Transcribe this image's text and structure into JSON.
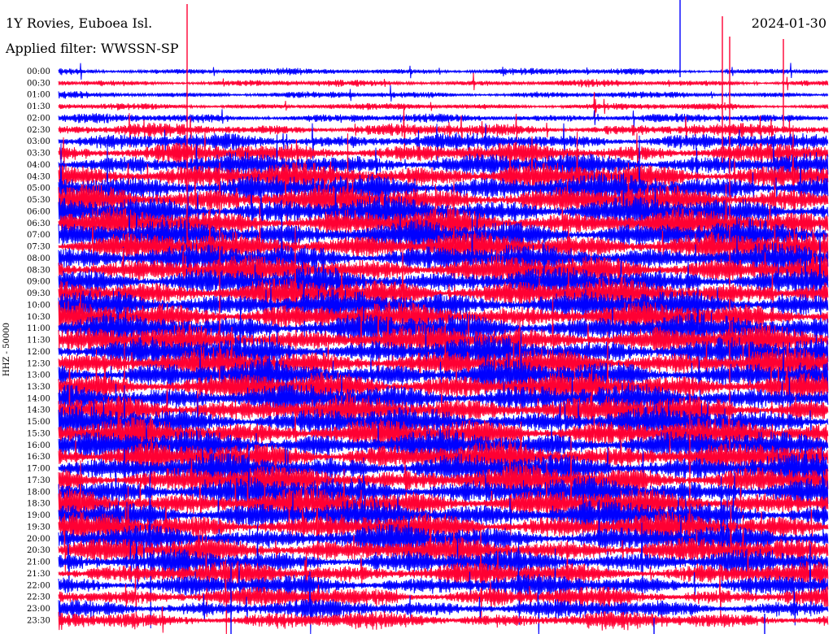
{
  "header": {
    "title": "1Y Rovies, Euboea Isl.",
    "filter": "Applied filter: WWSSN-SP",
    "date": "2024-01-30"
  },
  "chart_data": {
    "type": "line",
    "title": "1Y Rovies, Euboea Isl.",
    "subtitle": "Applied filter: WWSSN-SP",
    "date": "2024-01-30",
    "ylabel": "HHZ - 50000",
    "rows": [
      "00:00",
      "00:30",
      "01:00",
      "01:30",
      "02:00",
      "02:30",
      "03:00",
      "03:30",
      "04:00",
      "04:30",
      "05:00",
      "05:30",
      "06:00",
      "06:30",
      "07:00",
      "07:30",
      "08:00",
      "08:30",
      "09:00",
      "09:30",
      "10:00",
      "10:30",
      "11:00",
      "11:30",
      "12:00",
      "12:30",
      "13:00",
      "13:30",
      "14:00",
      "14:30",
      "15:00",
      "15:30",
      "16:00",
      "16:30",
      "17:00",
      "17:30",
      "18:00",
      "18:30",
      "19:00",
      "19:30",
      "20:00",
      "20:30",
      "21:00",
      "21:30",
      "22:00",
      "22:30",
      "23:00",
      "23:30"
    ],
    "series_colors": [
      "#0000ff",
      "#ff0033"
    ],
    "grid": false
  }
}
